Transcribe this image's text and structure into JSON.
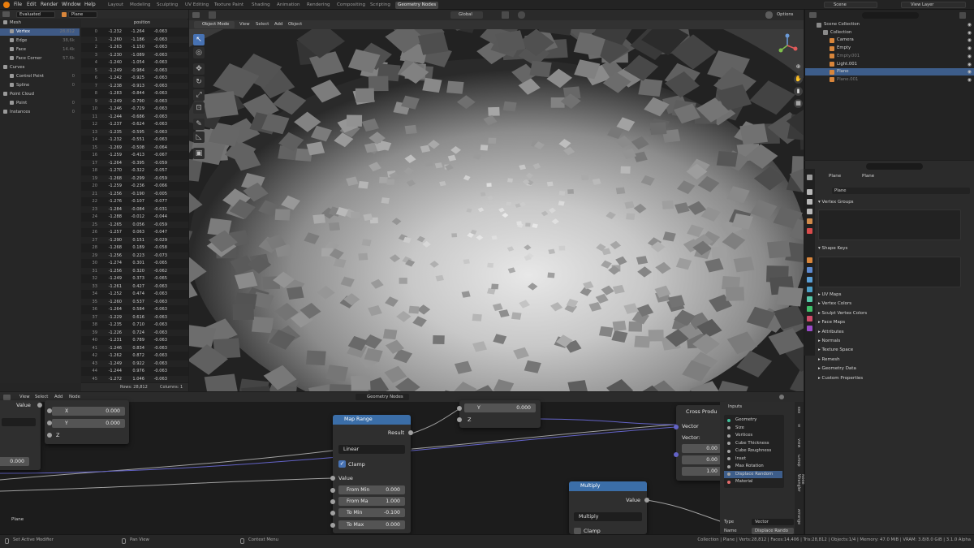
{
  "topbar": {
    "menus": [
      "File",
      "Edit",
      "Render",
      "Window",
      "Help"
    ],
    "workspaces": [
      "Layout",
      "Modeling",
      "Sculpting",
      "UV Editing",
      "Texture Paint",
      "Shading",
      "Animation",
      "Rendering",
      "Compositing",
      "Scripting",
      "Geometry Nodes"
    ],
    "active_workspace": "Geometry Nodes",
    "scene": "Scene",
    "view_layer": "View Layer"
  },
  "spreadsheet": {
    "mode": "Evaluated",
    "object": "Plane",
    "tree": [
      {
        "label": "Mesh",
        "count": "",
        "level": 0,
        "selected": false
      },
      {
        "label": "Vertex",
        "count": "28,812",
        "level": 1,
        "selected": true
      },
      {
        "label": "Edge",
        "count": "38,6k",
        "level": 1,
        "selected": false
      },
      {
        "label": "Face",
        "count": "14.4k",
        "level": 1,
        "selected": false
      },
      {
        "label": "Face Corner",
        "count": "57.6k",
        "level": 1,
        "selected": false
      },
      {
        "label": "Curves",
        "count": "",
        "level": 0,
        "selected": false
      },
      {
        "label": "Control Point",
        "count": "0",
        "level": 1,
        "selected": false
      },
      {
        "label": "Spline",
        "count": "0",
        "level": 1,
        "selected": false
      },
      {
        "label": "Point Cloud",
        "count": "",
        "level": 0,
        "selected": false
      },
      {
        "label": "Point",
        "count": "0",
        "level": 1,
        "selected": false
      },
      {
        "label": "Instances",
        "count": "0",
        "level": 0,
        "selected": false
      }
    ],
    "column": "position",
    "rows": [
      [
        0,
        "-1.232",
        "-1.264",
        "-0.063"
      ],
      [
        1,
        "-1.260",
        "-1.186",
        "-0.063"
      ],
      [
        2,
        "-1.263",
        "-1.150",
        "-0.063"
      ],
      [
        3,
        "-1.230",
        "-1.089",
        "-0.063"
      ],
      [
        4,
        "-1.240",
        "-1.054",
        "-0.063"
      ],
      [
        5,
        "-1.249",
        "-0.984",
        "-0.063"
      ],
      [
        6,
        "-1.242",
        "-0.925",
        "-0.063"
      ],
      [
        7,
        "-1.238",
        "-0.913",
        "-0.063"
      ],
      [
        8,
        "-1.283",
        "-0.844",
        "-0.063"
      ],
      [
        9,
        "-1.249",
        "-0.790",
        "-0.063"
      ],
      [
        10,
        "-1.246",
        "-0.729",
        "-0.063"
      ],
      [
        11,
        "-1.244",
        "-0.686",
        "-0.063"
      ],
      [
        12,
        "-1.237",
        "-0.624",
        "-0.063"
      ],
      [
        13,
        "-1.235",
        "-0.595",
        "-0.063"
      ],
      [
        14,
        "-1.232",
        "-0.551",
        "-0.063"
      ],
      [
        15,
        "-1.269",
        "-0.508",
        "-0.064"
      ],
      [
        16,
        "-1.259",
        "-0.413",
        "-0.067"
      ],
      [
        17,
        "-1.264",
        "-0.395",
        "-0.059"
      ],
      [
        18,
        "-1.270",
        "-0.322",
        "-0.057"
      ],
      [
        19,
        "-1.268",
        "-0.299",
        "-0.059"
      ],
      [
        20,
        "-1.259",
        "-0.236",
        "-0.066"
      ],
      [
        21,
        "-1.256",
        "-0.190",
        "-0.005"
      ],
      [
        22,
        "-1.276",
        "-0.107",
        "-0.077"
      ],
      [
        23,
        "-1.284",
        "-0.084",
        "-0.031"
      ],
      [
        24,
        "-1.288",
        "-0.012",
        "-0.044"
      ],
      [
        25,
        "-1.265",
        "0.056",
        "-0.059"
      ],
      [
        26,
        "-1.257",
        "0.063",
        "-0.047"
      ],
      [
        27,
        "-1.290",
        "0.151",
        "-0.029"
      ],
      [
        28,
        "-1.268",
        "0.189",
        "-0.058"
      ],
      [
        29,
        "-1.256",
        "0.223",
        "-0.073"
      ],
      [
        30,
        "-1.274",
        "0.301",
        "-0.065"
      ],
      [
        31,
        "-1.256",
        "0.320",
        "-0.062"
      ],
      [
        32,
        "-1.249",
        "0.373",
        "-0.065"
      ],
      [
        33,
        "-1.261",
        "0.427",
        "-0.063"
      ],
      [
        34,
        "-1.252",
        "0.474",
        "-0.063"
      ],
      [
        35,
        "-1.260",
        "0.537",
        "-0.063"
      ],
      [
        36,
        "-1.264",
        "0.584",
        "-0.063"
      ],
      [
        37,
        "-1.229",
        "0.616",
        "-0.063"
      ],
      [
        38,
        "-1.235",
        "0.710",
        "-0.063"
      ],
      [
        39,
        "-1.226",
        "0.724",
        "-0.063"
      ],
      [
        40,
        "-1.231",
        "0.789",
        "-0.063"
      ],
      [
        41,
        "-1.246",
        "0.834",
        "-0.063"
      ],
      [
        42,
        "-1.262",
        "0.872",
        "-0.063"
      ],
      [
        43,
        "-1.249",
        "0.922",
        "-0.063"
      ],
      [
        44,
        "-1.244",
        "0.976",
        "-0.063"
      ],
      [
        45,
        "-1.272",
        "1.046",
        "-0.063"
      ]
    ],
    "rows_label": "Rows: 28,812",
    "columns_label": "Columns: 1"
  },
  "viewport": {
    "mode": "Object Mode",
    "menus": [
      "View",
      "Select",
      "Add",
      "Object"
    ],
    "orientation": "Global",
    "options": "Options"
  },
  "outliner": {
    "title": "Scene Collection",
    "items": [
      {
        "label": "Scene Collection",
        "indent": 0,
        "color": "#8a8a8a",
        "selected": false,
        "dim": false
      },
      {
        "label": "Collection",
        "indent": 1,
        "color": "#8a8a8a",
        "selected": false,
        "dim": false
      },
      {
        "label": "Camera",
        "indent": 2,
        "color": "#d9863b",
        "selected": false,
        "dim": false
      },
      {
        "label": "Empty",
        "indent": 2,
        "color": "#d9863b",
        "selected": false,
        "dim": false
      },
      {
        "label": "Empty.001",
        "indent": 2,
        "color": "#d9863b",
        "selected": false,
        "dim": true
      },
      {
        "label": "Light.001",
        "indent": 2,
        "color": "#d9863b",
        "selected": false,
        "dim": false
      },
      {
        "label": "Plane",
        "indent": 2,
        "color": "#d9863b",
        "selected": true,
        "dim": false
      },
      {
        "label": "Plane.001",
        "indent": 2,
        "color": "#d9863b",
        "selected": false,
        "dim": true
      }
    ]
  },
  "properties": {
    "object": "Plane",
    "data": "Plane",
    "mesh_name": "Plane",
    "sections_top": [
      "Vertex Groups",
      "Shape Keys"
    ],
    "sections": [
      "UV Maps",
      "Vertex Colors",
      "Sculpt Vertex Colors",
      "Face Maps",
      "Attributes",
      "Normals",
      "Texture Space",
      "Remesh",
      "Geometry Data",
      "Custom Properties"
    ]
  },
  "node_editor": {
    "menus": [
      "View",
      "Select",
      "Add",
      "Node"
    ],
    "tree_name": "Geometry Nodes",
    "frame_label": "Plane",
    "value_label": "Value",
    "combine": {
      "x": "X",
      "x_val": "0.000",
      "y": "Y",
      "y_val": "0.000",
      "z": "Z"
    },
    "left_value": "0.000",
    "y_node": {
      "y": "Y",
      "y_val": "0.000",
      "z": "Z"
    },
    "map_range": {
      "title": "Map Range",
      "result": "Result",
      "mode": "Linear",
      "clamp": "Clamp",
      "value": "Value",
      "from_min_l": "From Min",
      "from_min": "0.000",
      "from_max_l": "From Ma",
      "from_max": "1.000",
      "to_min_l": "To Min",
      "to_min": "-0.100",
      "to_max_l": "To Max",
      "to_max": "0.000"
    },
    "multiply": {
      "title": "Multiply",
      "value": "Value",
      "mode": "Multiply",
      "clamp": "Clamp"
    },
    "cross": {
      "title": "Cross Produ",
      "vector": "Vector",
      "vector2": "Vector:",
      "v1": "0.00",
      "v2": "0.00",
      "v3": "1.00"
    },
    "panel": {
      "title": "Inputs",
      "inputs": [
        {
          "label": "Geometry",
          "color": "#3fbf9a"
        },
        {
          "label": "Size",
          "color": "#a1a1a1"
        },
        {
          "label": "Vertices",
          "color": "#a1a1a1"
        },
        {
          "label": "Cube Thickness",
          "color": "#a1a1a1"
        },
        {
          "label": "Cube Roughness",
          "color": "#a1a1a1"
        },
        {
          "label": "Inset",
          "color": "#a1a1a1"
        },
        {
          "label": "Max Rotation",
          "color": "#a1a1a1"
        },
        {
          "label": "Displace Random",
          "color": "#a1a1a1"
        },
        {
          "label": "Material",
          "color": "#e36b6b"
        }
      ],
      "type_label": "Type",
      "type_val": "Vector",
      "name_label": "Name",
      "name_val": "Displace Rando"
    },
    "tabs": [
      "Tool",
      "Vi",
      "View",
      "Group",
      "Node Wrangler",
      "Arrange"
    ]
  },
  "status": {
    "left": "Set Active Modifier",
    "pan": "Pan View",
    "ctx": "Context Menu",
    "right": "Collection | Plane | Verts:28,812 | Faces:14,406 | Tris:28,812 | Objects:1/4 | Memory: 47.0 MiB | VRAM: 3.8/8.0 GiB | 3.1.0 Alpha"
  }
}
